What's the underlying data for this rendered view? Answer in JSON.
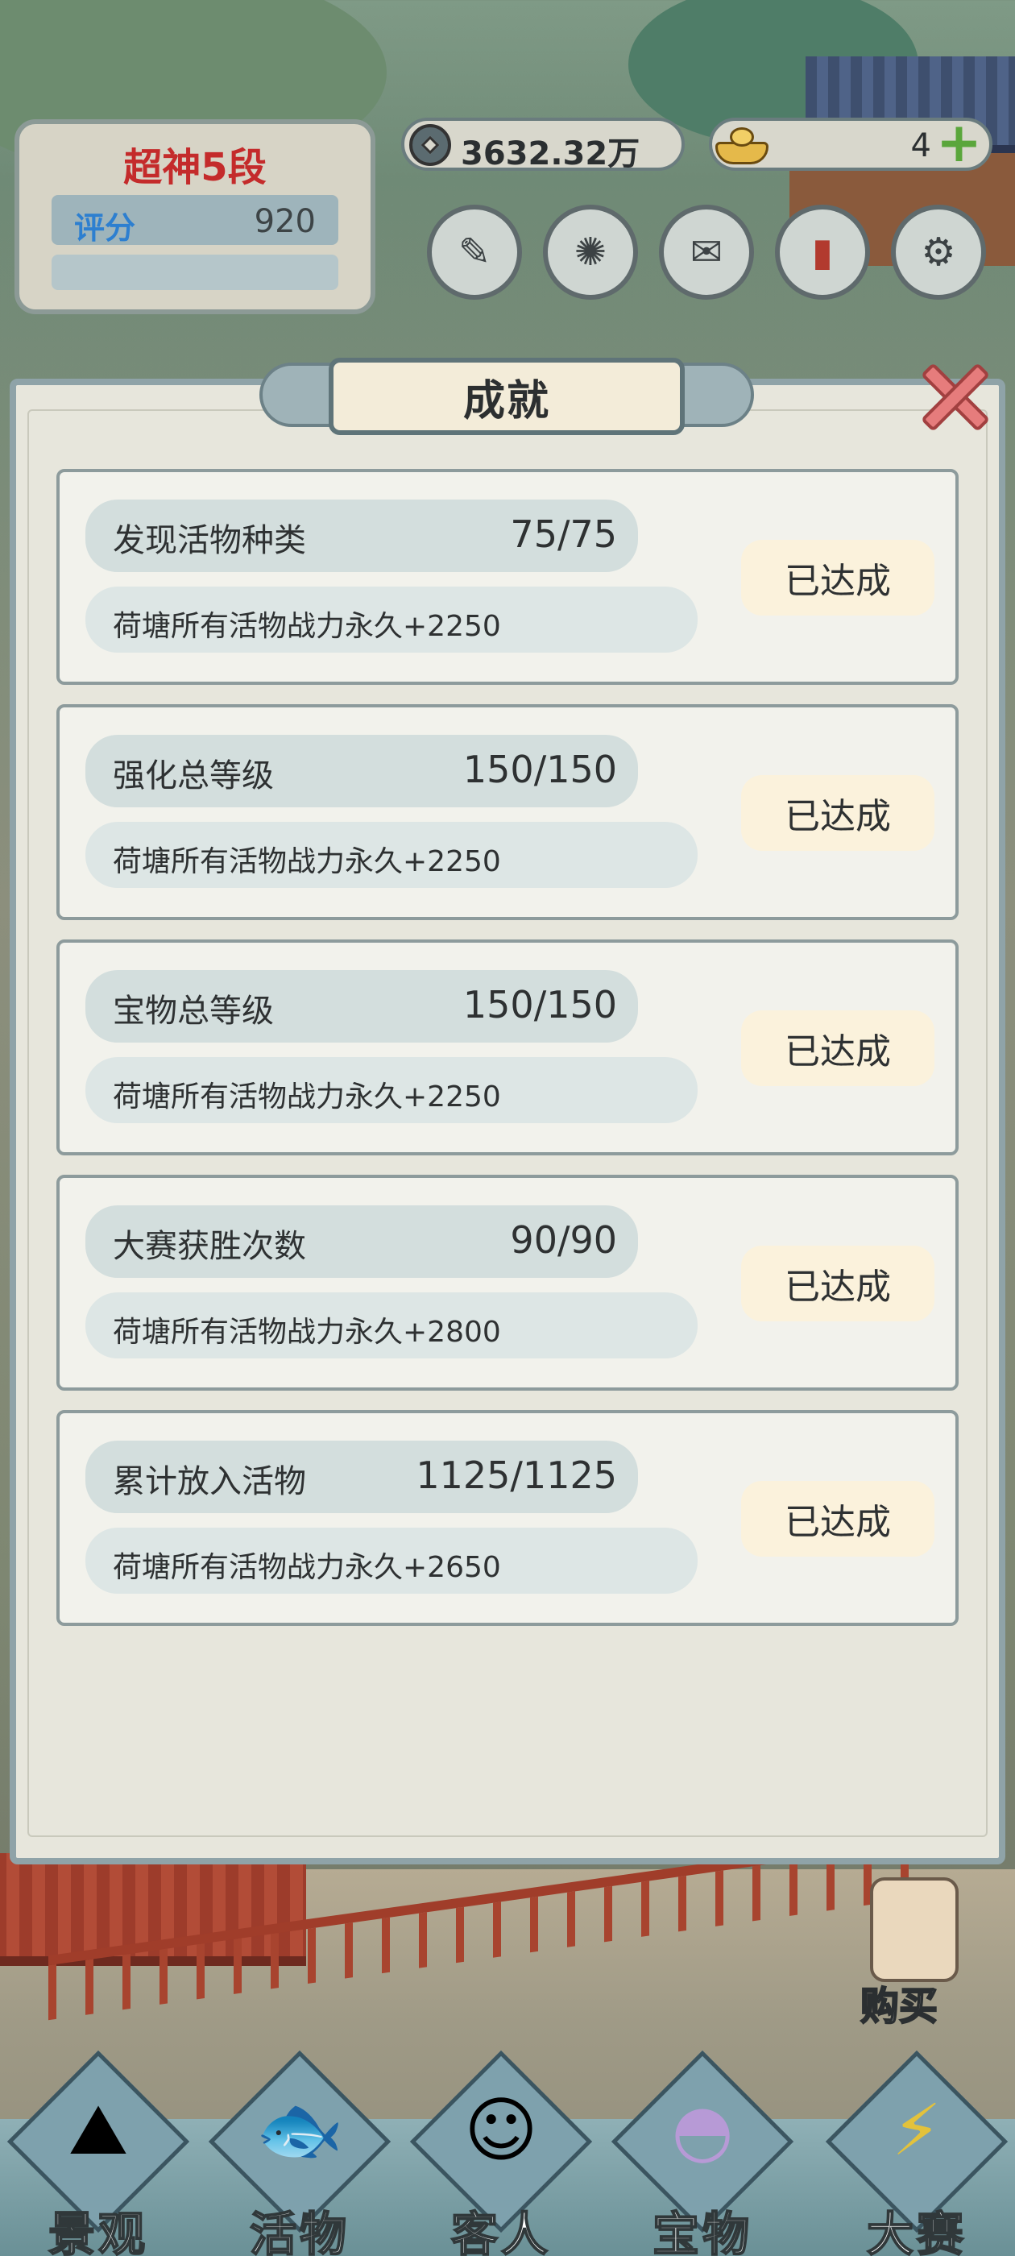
{
  "hud": {
    "rank_title": "超神5段",
    "score_label": "评分",
    "score_value": "920",
    "coins": "3632.32万",
    "ingots": "4"
  },
  "toolbar": {
    "icons": [
      "brush-icon",
      "compass-icon",
      "scroll-icon",
      "book-icon",
      "gear-icon"
    ]
  },
  "panel": {
    "title": "成就"
  },
  "achievements": [
    {
      "name": "发现活物种类",
      "progress": "75/75",
      "reward": "荷塘所有活物战力永久+2250",
      "status": "已达成"
    },
    {
      "name": "强化总等级",
      "progress": "150/150",
      "reward": "荷塘所有活物战力永久+2250",
      "status": "已达成"
    },
    {
      "name": "宝物总等级",
      "progress": "150/150",
      "reward": "荷塘所有活物战力永久+2250",
      "status": "已达成"
    },
    {
      "name": "大赛获胜次数",
      "progress": "90/90",
      "reward": "荷塘所有活物战力永久+2800",
      "status": "已达成"
    },
    {
      "name": "累计放入活物",
      "progress": "1125/1125",
      "reward": "荷塘所有活物战力永久+2650",
      "status": "已达成"
    }
  ],
  "shop": {
    "label": "购买"
  },
  "nav": [
    {
      "label": "景观",
      "icon": "rock-icon"
    },
    {
      "label": "活物",
      "icon": "fish-icon"
    },
    {
      "label": "客人",
      "icon": "guest-icon"
    },
    {
      "label": "宝物",
      "icon": "shell-icon"
    },
    {
      "label": "大赛",
      "icon": "trophy-icon"
    }
  ]
}
